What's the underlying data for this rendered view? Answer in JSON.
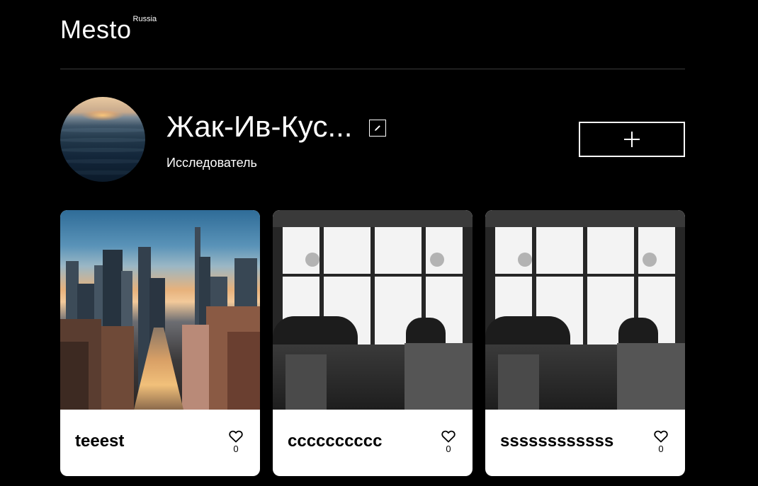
{
  "header": {
    "logo_text": "Mesto",
    "logo_subtext": "Russia"
  },
  "profile": {
    "name": "Жак-Ив-Кус...",
    "about": "Исследователь",
    "avatar_alt": "ocean-sunset-avatar",
    "edit_icon": "pencil-icon",
    "add_icon": "plus-icon"
  },
  "cards": [
    {
      "title": "teeest",
      "likes": "0",
      "image": "city-street-photo"
    },
    {
      "title": "cccccccccc",
      "likes": "0",
      "image": "cafe-silhouettes-photo"
    },
    {
      "title": "ssssssssssss",
      "likes": "0",
      "image": "cafe-silhouettes-photo"
    }
  ],
  "colors": {
    "background": "#000000",
    "card_background": "#ffffff",
    "divider": "#545454"
  }
}
